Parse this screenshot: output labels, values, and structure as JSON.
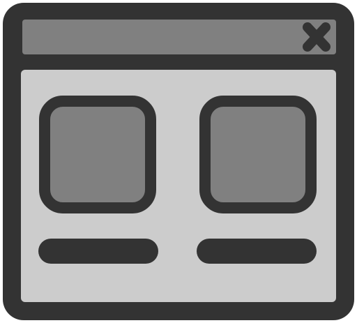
{
  "icon": {
    "name": "application-window-icon",
    "colors": {
      "outline": "#333333",
      "titlebar": "#808080",
      "body": "#cccccc",
      "tile": "#808080",
      "close_glyph": "#333333"
    },
    "tiles": [
      "tile-left",
      "tile-right"
    ],
    "captions": [
      "caption-left",
      "caption-right"
    ]
  }
}
